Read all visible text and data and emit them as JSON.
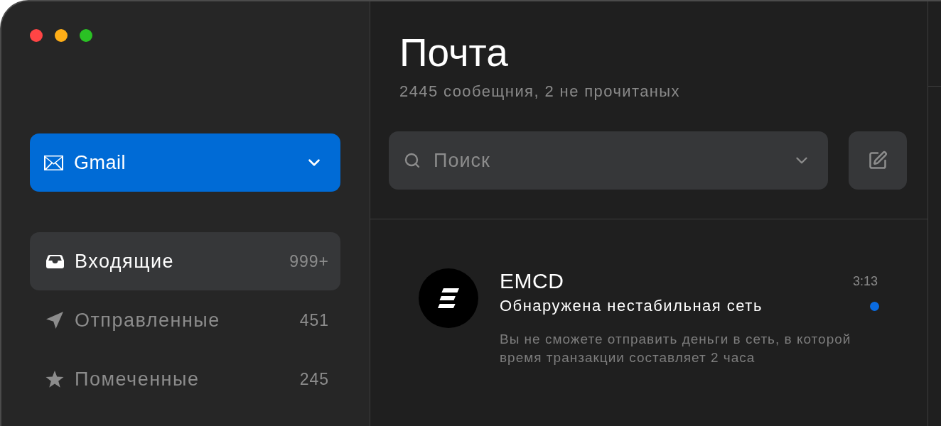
{
  "window": {
    "controls": [
      {
        "color": "#ff4545"
      },
      {
        "color": "#ffae17"
      },
      {
        "color": "#2ac124"
      }
    ]
  },
  "sidebar": {
    "account": {
      "label": "Gmail"
    },
    "items": [
      {
        "kind": "inbox",
        "label": "Входящие",
        "count": "999+",
        "selected": true
      },
      {
        "kind": "sent",
        "label": "Отправленные",
        "count": "451",
        "selected": false
      },
      {
        "kind": "starred",
        "label": "Помеченные",
        "count": "245",
        "selected": false
      }
    ]
  },
  "main": {
    "title": "Почта",
    "subtitle": "2445 сообещния, 2 не прочитаных",
    "search": {
      "placeholder": "Поиск"
    }
  },
  "messages": [
    {
      "sender": "EMCD",
      "time": "3:13",
      "subject": "Обнаружена нестабильная сеть",
      "preview": "Вы не сможете отправить деньги в сеть, в которой время транзакции составляет 2 часа",
      "unread": true
    }
  ]
}
